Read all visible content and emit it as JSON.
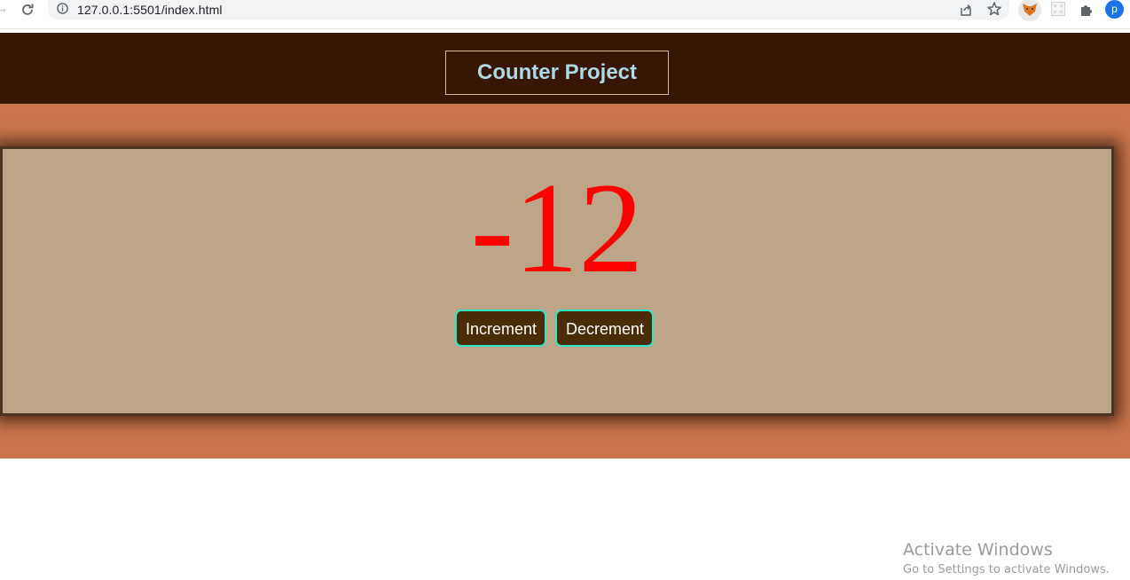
{
  "browser": {
    "url": "127.0.0.1:5501/index.html",
    "profile_initial": "p",
    "icons": {
      "forward": "arrow-right-icon",
      "reload": "reload-icon",
      "info": "info-icon",
      "share": "share-icon",
      "bookmark": "star-icon",
      "extension_1": "fox-extension-icon",
      "extension_2": "grid-extension-icon",
      "extensions": "puzzle-icon"
    }
  },
  "header": {
    "title": "Counter Project",
    "background": "#371603",
    "title_color": "#add8e6"
  },
  "counter": {
    "value": "-12",
    "value_color": "#ff0000",
    "increment_label": "Increment",
    "decrement_label": "Decrement",
    "card_background": "#bda587",
    "section_background": "#c9744b",
    "button_background": "#4a2c07",
    "button_border": "#2ee6c8"
  },
  "watermark": {
    "title": "Activate Windows",
    "subtitle": "Go to Settings to activate Windows."
  }
}
